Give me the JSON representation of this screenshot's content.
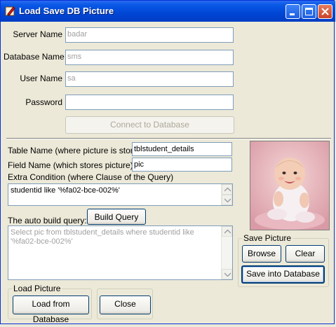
{
  "window": {
    "title": "Load Save DB Picture",
    "minimize_icon": "minimize-icon",
    "maximize_icon": "maximize-icon",
    "close_icon": "close-icon"
  },
  "connection": {
    "server_label": "Server Name",
    "server_value": "badar",
    "database_label": "Database Name",
    "database_value": "sms",
    "user_label": "User Name",
    "user_value": "sa",
    "password_label": "Password",
    "password_value": "",
    "connect_button": "Connect to Database"
  },
  "query": {
    "table_label": "Table Name (where picture is stored)",
    "table_value": "tblstudent_details",
    "field_label": "Field Name (which stores picture)",
    "field_value": "pic",
    "extra_label": "Extra Condition (where Clause of the Query)",
    "extra_value": "studentid like '%fa02-bce-002%'",
    "auto_label": "The auto build query:",
    "build_button": "Build Query",
    "auto_value": "Select pic from tblstudent_details where studentid like '%fa02-bce-002%'"
  },
  "save_picture": {
    "legend": "Save Picture",
    "browse_button": "Browse",
    "clear_button": "Clear",
    "save_button": "Save into Database"
  },
  "load_picture": {
    "legend": "Load Picture",
    "load_button": "Load from Database"
  },
  "close_button": "Close",
  "picture": {
    "icon": "baby-photo"
  },
  "colors": {
    "titlebar": "#0046d5",
    "face": "#ece9d8",
    "input_border": "#7f9db9"
  }
}
